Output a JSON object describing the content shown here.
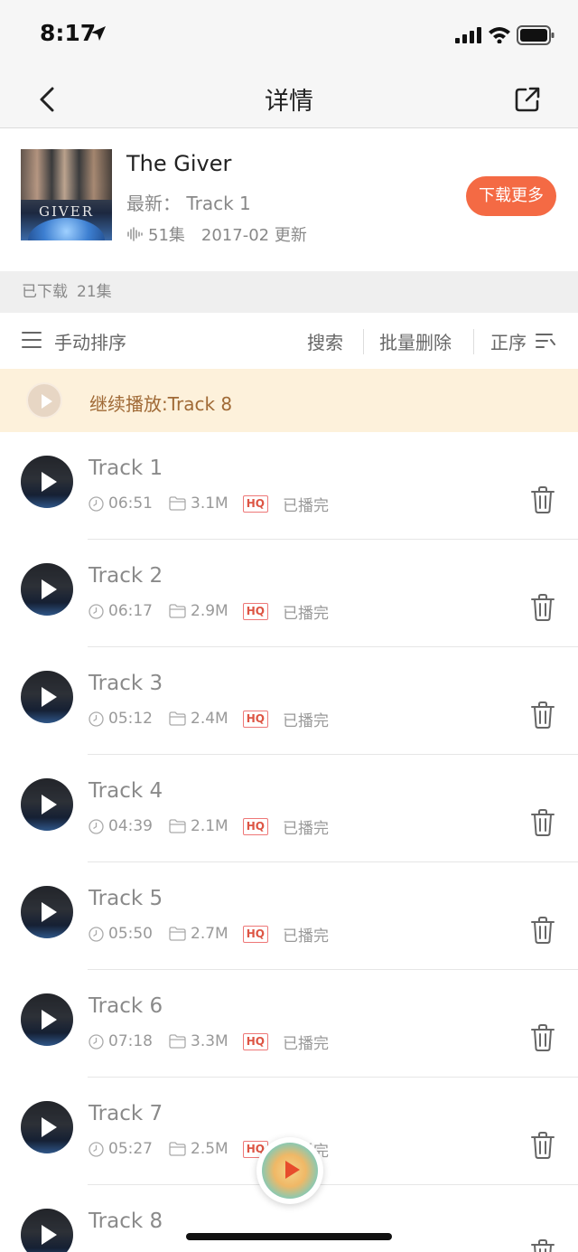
{
  "status_bar": {
    "time": "8:17"
  },
  "nav": {
    "title": "详情"
  },
  "album": {
    "cover_text": "GIVER",
    "title": "The Giver",
    "latest": "最新：  Track 1",
    "episodes": "51集",
    "updated": "2017-02 更新",
    "download_more": "下载更多"
  },
  "downloaded": {
    "label": "已下载",
    "count": "21集"
  },
  "toolbar": {
    "manual_sort": "手动排序",
    "search": "搜索",
    "batch_delete": "批量删除",
    "order": "正序"
  },
  "resume": {
    "label": "继续播放:Track 8"
  },
  "tracks": [
    {
      "name": "Track 1",
      "duration": "06:51",
      "size": "3.1M",
      "quality": "HQ",
      "status": "已播完"
    },
    {
      "name": "Track 2",
      "duration": "06:17",
      "size": "2.9M",
      "quality": "HQ",
      "status": "已播完"
    },
    {
      "name": "Track 3",
      "duration": "05:12",
      "size": "2.4M",
      "quality": "HQ",
      "status": "已播完"
    },
    {
      "name": "Track 4",
      "duration": "04:39",
      "size": "2.1M",
      "quality": "HQ",
      "status": "已播完"
    },
    {
      "name": "Track 5",
      "duration": "05:50",
      "size": "2.7M",
      "quality": "HQ",
      "status": "已播完"
    },
    {
      "name": "Track 6",
      "duration": "07:18",
      "size": "3.3M",
      "quality": "HQ",
      "status": "已播完"
    },
    {
      "name": "Track 7",
      "duration": "05:27",
      "size": "2.5M",
      "quality": "HQ",
      "status": "已播完"
    },
    {
      "name": "Track 8",
      "duration": "",
      "size": "",
      "quality": "",
      "status": ""
    }
  ],
  "colors": {
    "accent": "#f46a44",
    "resume_bg": "#fdf1db",
    "resume_text": "#a06a36"
  },
  "icons": [
    "location-arrow-icon",
    "signal-icon",
    "wifi-icon",
    "battery-icon",
    "back-chevron-icon",
    "share-icon",
    "waveform-icon",
    "menu-lines-icon",
    "sort-order-icon",
    "play-icon",
    "clock-icon",
    "folder-icon",
    "trash-icon"
  ]
}
